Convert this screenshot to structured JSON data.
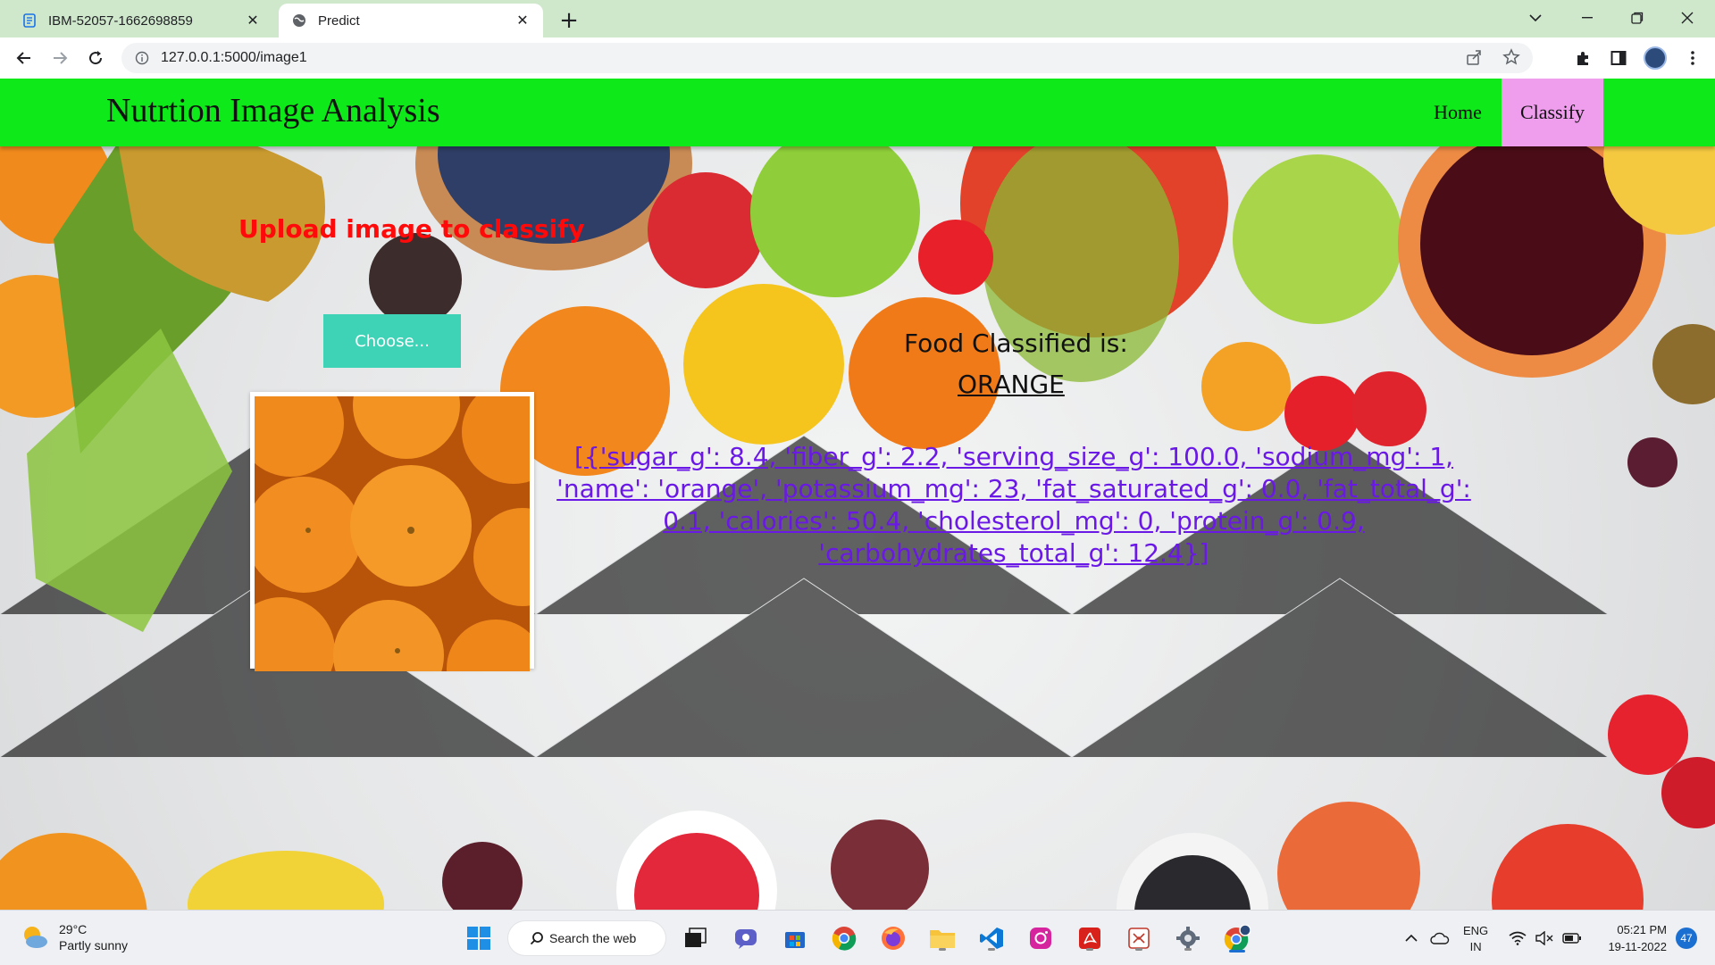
{
  "browser": {
    "tabs": [
      {
        "title": "IBM-52057-1662698859",
        "icon": "document-icon",
        "active": false
      },
      {
        "title": "Predict",
        "icon": "globe-icon",
        "active": true
      }
    ],
    "url": "127.0.0.1:5000/image1"
  },
  "page": {
    "brand": "Nutrtion Image Analysis",
    "nav": {
      "home": "Home",
      "classify": "Classify"
    },
    "upload_title": "Upload image to classify",
    "choose_label": "Choose...",
    "result_label": "Food Classified is:",
    "result_value": "ORANGE",
    "nutrition_text": "[{'sugar_g': 8.4, 'fiber_g': 2.2, 'serving_size_g': 100.0, 'sodium_mg': 1, 'name': 'orange', 'potassium_mg': 23, 'fat_saturated_g': 0.0, 'fat_total_g': 0.1, 'calories': 50.4, 'cholesterol_mg': 0, 'protein_g': 0.9, 'carbohydrates_total_g': 12.4}]",
    "colors": {
      "navbar": "#0ee919",
      "classify_active": "#ef9ded",
      "upload_title": "#ff0a0a",
      "choose_button": "#3ed2b6",
      "nutrition_link": "#6a18e6"
    }
  },
  "taskbar": {
    "weather_temp": "29°C",
    "weather_desc": "Partly sunny",
    "search_label": "Search the web",
    "lang_line1": "ENG",
    "lang_line2": "IN",
    "time": "05:21 PM",
    "date": "19-11-2022",
    "notifications": "47"
  }
}
